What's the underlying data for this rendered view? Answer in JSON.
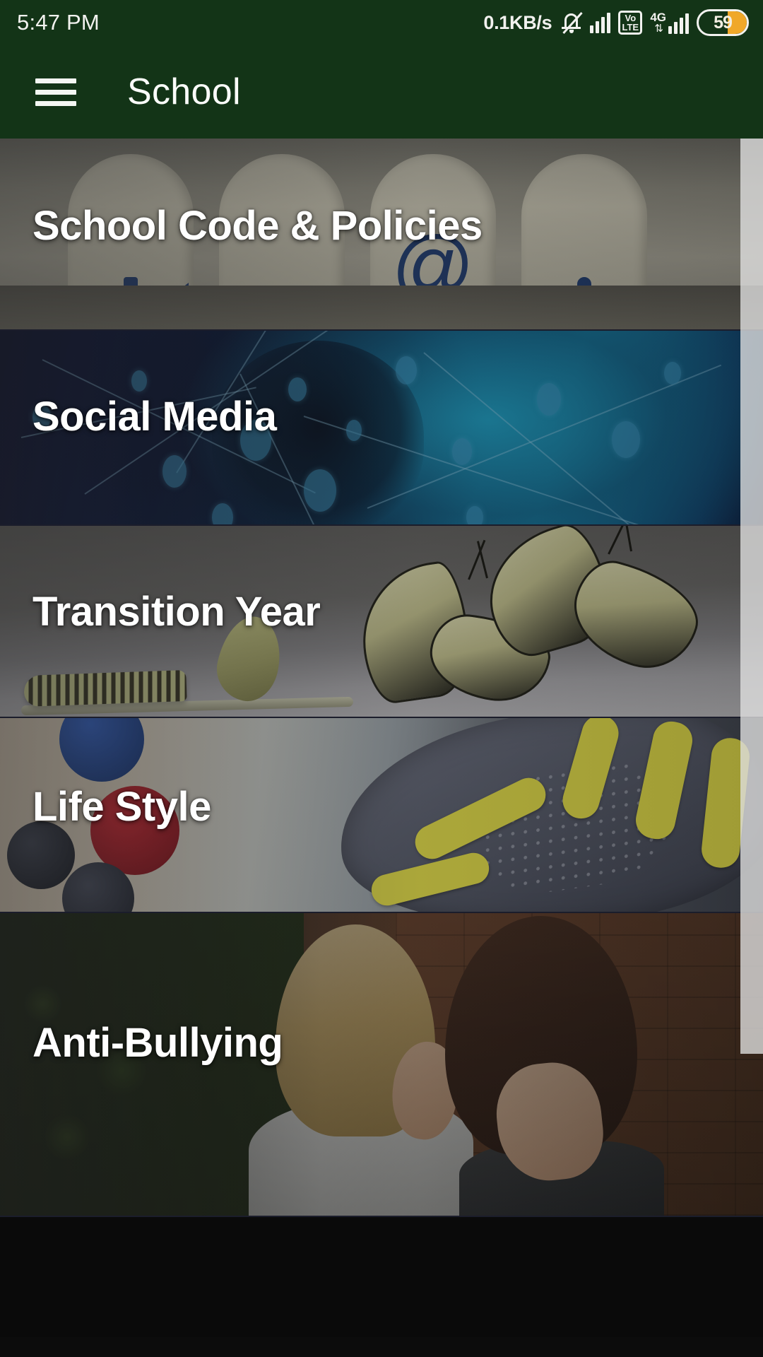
{
  "status_bar": {
    "time": "5:47 PM",
    "network_speed": "0.1KB/s",
    "icons": [
      "bell-muted-icon",
      "signal-bars-icon",
      "volte-icon",
      "4g-icon",
      "signal-bars-2-icon",
      "battery-icon"
    ],
    "volte_top": "Vo",
    "volte_bottom": "LTE",
    "network_type": "4G",
    "data_arrows": "⇅",
    "battery_percent": "59"
  },
  "app_bar": {
    "menu_icon": "hamburger-menu-icon",
    "title": "School"
  },
  "colors": {
    "app_bar_bg": "#133417",
    "status_bar_bg": "#133417",
    "title_text": "#ffffff",
    "battery_fill": "#f0a829",
    "card_label_text": "#ffffff"
  },
  "list": {
    "items": [
      {
        "label": "School Code & Policies",
        "image": "wooden-blocks-contact-icons"
      },
      {
        "label": "Social Media",
        "image": "blue-network-nodes-head"
      },
      {
        "label": "Transition Year",
        "image": "butterfly-metamorphosis"
      },
      {
        "label": "Life Style",
        "image": "berries-and-running-shoe"
      },
      {
        "label": "Anti-Bullying",
        "image": "two-girls-whispering-brick-wall"
      }
    ]
  },
  "scrollbar": {
    "visible": true,
    "position": "right"
  }
}
